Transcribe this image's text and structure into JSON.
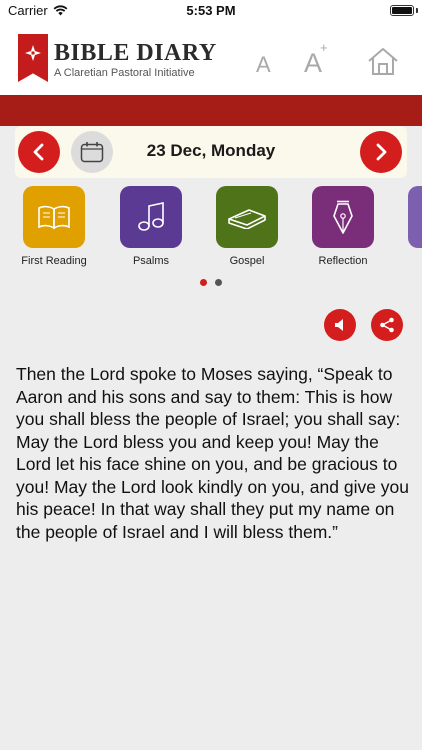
{
  "status_bar": {
    "carrier": "Carrier",
    "time": "5:53 PM"
  },
  "header": {
    "title": "BIBLE DIARY",
    "subtitle": "A Claretian Pastoral Initiative",
    "font_small_label": "A",
    "font_large_label": "A",
    "font_large_plus": "+"
  },
  "date_nav": {
    "date": "23 Dec, Monday"
  },
  "tiles": [
    {
      "label": "First Reading",
      "color": "#e0a000",
      "icon": "open-book-icon"
    },
    {
      "label": "Psalms",
      "color": "#5b3a94",
      "icon": "music-note-icon"
    },
    {
      "label": "Gospel",
      "color": "#4e7318",
      "icon": "closed-book-icon"
    },
    {
      "label": "Reflection",
      "color": "#7a2e7a",
      "icon": "pen-nib-icon"
    },
    {
      "label": "",
      "color": "#7d5fb0",
      "icon": "partial-tile"
    }
  ],
  "pager": {
    "pages": 2,
    "active": 1
  },
  "reading_text": "Then the Lord spoke to Moses saying, “Speak to Aaron and his sons and say to them: This is how you shall bless the people of Israel; you shall say: May the Lord bless you and keep you! May the Lord let his face shine on you, and be gracious to you! May the Lord look kindly on you, and give you his peace! In that way shall they put my name on the people of Israel and I will bless them.”",
  "colors": {
    "accent_red": "#d41e1e",
    "band_red": "#a61c16",
    "background": "#ededed",
    "date_bar_bg": "#fbf8ec"
  }
}
